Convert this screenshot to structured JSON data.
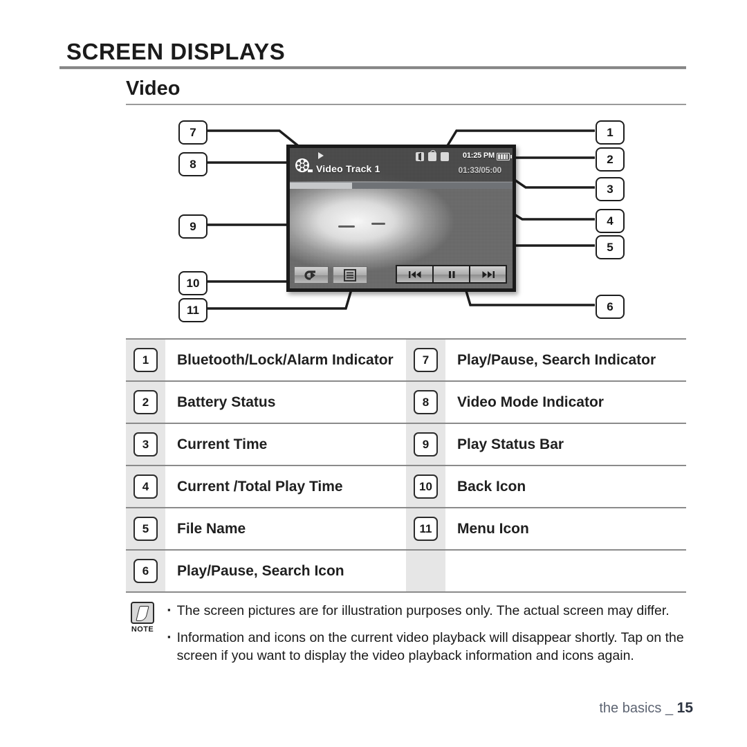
{
  "header": {
    "title": "SCREEN DISPLAYS",
    "section": "Video"
  },
  "device_screen": {
    "mode_icon": "film-reel-icon",
    "play_indicator": "play-triangle-icon",
    "file_name": "Video Track 1",
    "status_icons": [
      "bluetooth-icon",
      "lock-icon",
      "alarm-icon"
    ],
    "current_time": "01:25 PM",
    "battery": "battery-icon",
    "play_time": "01:33/05:00",
    "progress_percent": 28,
    "controls": {
      "back": "back-icon",
      "menu": "menu-icon",
      "previous": "previous-icon",
      "pause": "pause-icon",
      "next": "next-icon"
    }
  },
  "callouts": {
    "left": [
      "7",
      "8",
      "9",
      "10",
      "11"
    ],
    "right": [
      "1",
      "2",
      "3",
      "4",
      "5",
      "6"
    ]
  },
  "legend": {
    "rows": [
      {
        "left_num": "1",
        "left_text": "Bluetooth/Lock/Alarm Indicator",
        "right_num": "7",
        "right_text": "Play/Pause, Search Indicator"
      },
      {
        "left_num": "2",
        "left_text": "Battery Status",
        "right_num": "8",
        "right_text": "Video Mode Indicator"
      },
      {
        "left_num": "3",
        "left_text": "Current Time",
        "right_num": "9",
        "right_text": "Play Status Bar"
      },
      {
        "left_num": "4",
        "left_text": "Current /Total Play Time",
        "right_num": "10",
        "right_text": "Back Icon"
      },
      {
        "left_num": "5",
        "left_text": "File Name",
        "right_num": "11",
        "right_text": "Menu Icon"
      },
      {
        "left_num": "6",
        "left_text": "Play/Pause, Search Icon",
        "right_num": "",
        "right_text": ""
      }
    ]
  },
  "note": {
    "label": "NOTE",
    "items": [
      "The screen pictures are for illustration purposes only. The actual screen may differ.",
      "Information and icons on the current video playback will disappear shortly. Tap on the screen if you want to display the video playback information and icons again."
    ]
  },
  "footer": {
    "text": "the basics _",
    "page": "15"
  }
}
